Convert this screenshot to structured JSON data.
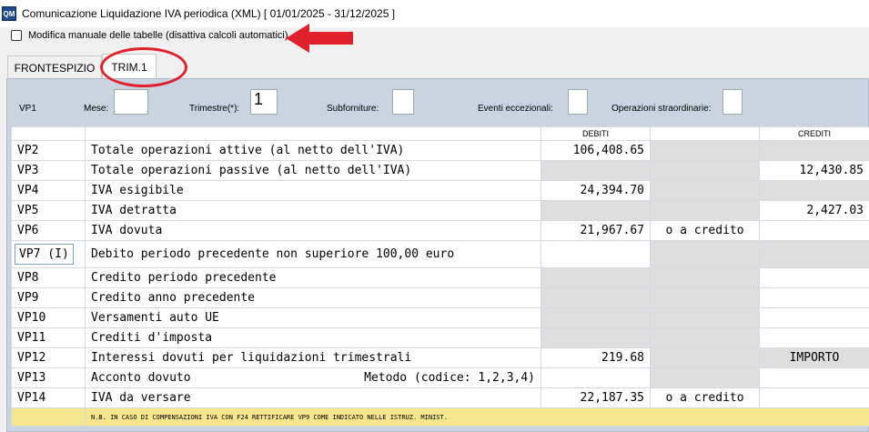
{
  "window": {
    "icon": "QM",
    "title": "Comunicazione Liquidazione IVA periodica (XML)  [ 01/01/2025 - 31/12/2025 ]"
  },
  "options": {
    "manual_edit_label": "Modifica manuale delle tabelle (disattiva calcoli automatici)",
    "manual_edit_checked": false
  },
  "tabs": [
    {
      "label": "FRONTESPIZIO",
      "active": false
    },
    {
      "label": "TRIM.1",
      "active": true
    }
  ],
  "vp1": {
    "code": "VP1",
    "mese_label": "Mese:",
    "mese_value": "",
    "trimestre_label": "Trimestre(*):",
    "trimestre_value": "1",
    "subforniture_label": "Subforniture:",
    "subforniture_value": "",
    "eventi_label": "Eventi eccezionali:",
    "eventi_value": "",
    "operazioni_label": "Operazioni straordinarie:",
    "operazioni_value": ""
  },
  "columns": {
    "debiti": "DEBITI",
    "crediti": "CREDITI"
  },
  "rows": [
    {
      "code": "VP2",
      "desc": "Totale operazioni attive (al netto dell'IVA)",
      "debiti": "106,408.65",
      "middle": "",
      "crediti": ""
    },
    {
      "code": "VP3",
      "desc": "Totale operazioni passive (al netto dell'IVA)",
      "debiti": "",
      "middle": "",
      "crediti": "12,430.85"
    },
    {
      "code": "VP4",
      "desc": "IVA esigibile",
      "debiti": "24,394.70",
      "middle": "",
      "crediti": ""
    },
    {
      "code": "VP5",
      "desc": "IVA detratta",
      "debiti": "",
      "middle": "",
      "crediti": "2,427.03"
    },
    {
      "code": "VP6",
      "desc": "IVA dovuta",
      "debiti": "21,967.67",
      "middle": "o a credito",
      "crediti": ""
    },
    {
      "code": "VP7 (I)",
      "desc": "Debito periodo precedente non superiore 100,00 euro",
      "debiti": "",
      "middle": "",
      "crediti": ""
    },
    {
      "code": "VP8",
      "desc": "Credito periodo precedente",
      "debiti": "",
      "middle": "",
      "crediti": ""
    },
    {
      "code": "VP9",
      "desc": "Credito anno precedente",
      "debiti": "",
      "middle": "",
      "crediti": ""
    },
    {
      "code": "VP10",
      "desc": "Versamenti auto UE",
      "debiti": "",
      "middle": "",
      "crediti": ""
    },
    {
      "code": "VP11",
      "desc": "Crediti d'imposta",
      "debiti": "",
      "middle": "",
      "crediti": ""
    },
    {
      "code": "VP12",
      "desc": "Interessi dovuti per liquidazioni trimestrali",
      "debiti": "219.68",
      "middle": "",
      "crediti": "IMPORTO"
    },
    {
      "code": "VP13",
      "desc": "Acconto dovuto",
      "desc_right": "Metodo (codice: 1,2,3,4)",
      "debiti": "",
      "middle": "",
      "crediti": ""
    },
    {
      "code": "VP14",
      "desc": "IVA da versare",
      "debiti": "22,187.35",
      "middle": "o a credito",
      "crediti": ""
    }
  ],
  "note": "N.B. IN CASO DI COMPENSAZIONI IVA CON F24 RETTIFICARE VP9 COME INDICATO NELLE ISTRUZ. MINIST.",
  "colors": {
    "annotation_red": "#e0202a",
    "note_bg": "#f6e68e",
    "panel_bg": "#c9d4e0"
  }
}
